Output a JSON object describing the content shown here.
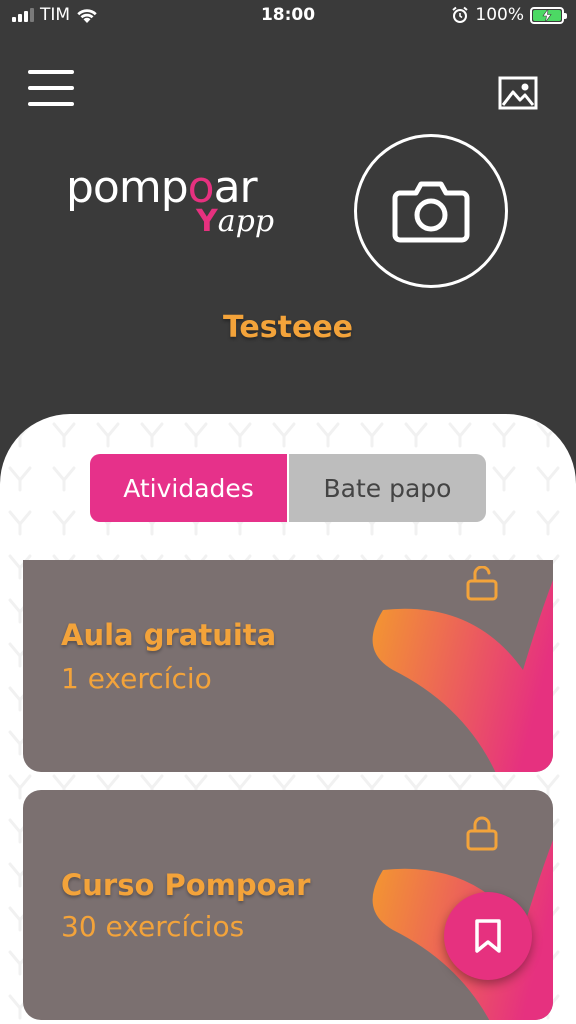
{
  "status_bar": {
    "carrier": "TIM",
    "time": "18:00",
    "battery_percent": "100%"
  },
  "header": {
    "logo_text_main_a": "pomp",
    "logo_text_main_b": "o",
    "logo_text_main_c": "ar",
    "logo_text_sub_y": "Y",
    "logo_text_sub_rest": "app",
    "username": "Testeee"
  },
  "tabs": [
    {
      "label": "Atividades",
      "active": true
    },
    {
      "label": "Bate papo",
      "active": false
    }
  ],
  "cards": [
    {
      "title": "Aula gratuita",
      "subtitle": "1 exercício",
      "lock": "unlocked-icon"
    },
    {
      "title": "Curso Pompoar",
      "subtitle": "30 exercícios",
      "lock": "locked-icon"
    }
  ],
  "colors": {
    "header_bg": "#3a3a3a",
    "accent_pink": "#e6317f",
    "accent_orange": "#f3a33a",
    "card_bg": "#7b7070",
    "tab_inactive": "#bdbdbd"
  }
}
